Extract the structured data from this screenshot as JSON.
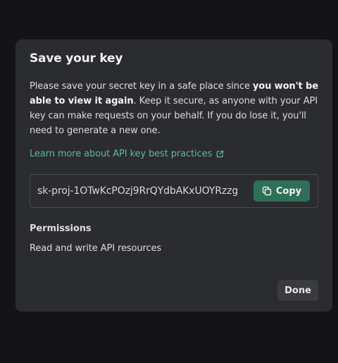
{
  "dialog": {
    "title": "Save your key",
    "description": {
      "part1": "Please save your secret key in a safe place since ",
      "bold": "you won't be able to view it again",
      "part2": ". Keep it secure, as anyone with your API key can make requests on your behalf. If you do lose it, you'll need to generate a new one."
    },
    "learn_more_link": "Learn more about API key best practices",
    "key_value": "sk-proj-1OTwKcPOzj9RrQYdbAKxUOYRzzg",
    "copy_label": "Copy",
    "permissions_title": "Permissions",
    "permissions_value": "Read and write API resources",
    "done_label": "Done"
  },
  "colors": {
    "page_bg": "#141416",
    "modal_bg": "#2b2c30",
    "link": "#5fb79a",
    "copy_button_bg": "#2f6f58",
    "done_button_bg": "#3a3b40"
  },
  "icons": {
    "link_icon": "external-link-icon",
    "copy_icon": "copy-icon"
  }
}
